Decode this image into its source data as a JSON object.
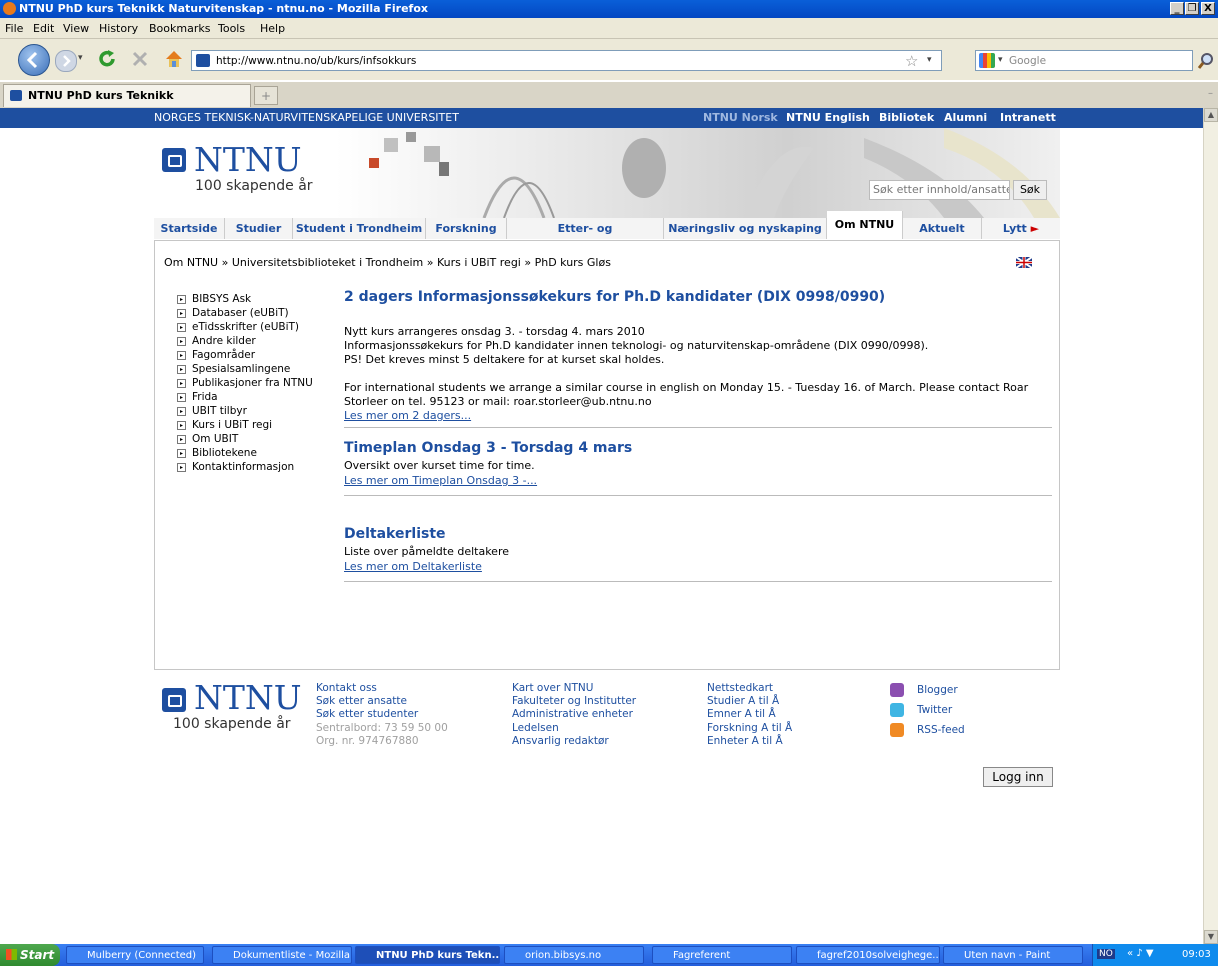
{
  "window": {
    "title": "NTNU PhD kurs Teknikk Naturvitenskap - ntnu.no - Mozilla Firefox",
    "min": "_",
    "max": "❐",
    "close": "X"
  },
  "menu": [
    "File",
    "Edit",
    "View",
    "History",
    "Bookmarks",
    "Tools",
    "Help"
  ],
  "toolbar": {
    "url": "http://www.ntnu.no/ub/kurs/infsokkurs",
    "search_placeholder": "Google",
    "star": "☆",
    "dropdown": "▾"
  },
  "tab": {
    "label": "NTNU PhD kurs Teknikk Naturvitensk...",
    "new": "+"
  },
  "site": {
    "university": "NORGES TEKNISK-NATURVITENSKAPELIGE UNIVERSITET",
    "toplinks": [
      "NTNU Norsk",
      "NTNU English",
      "Bibliotek",
      "Alumni",
      "Intranett"
    ],
    "logo": "NTNU",
    "logo_sub": "100 skapende år",
    "search_placeholder": "Søk etter innhold/ansatte",
    "search_button": "Søk",
    "tabs": [
      "Startside",
      "Studier",
      "Student i Trondheim",
      "Forskning",
      "Etter- og videreutdanning",
      "Næringsliv og nyskaping",
      "Om NTNU",
      "Aktuelt",
      "Lytt"
    ],
    "breadcrumb": "Om NTNU » Universitetsbiblioteket i Trondheim » Kurs i UBiT regi » PhD kurs Gløs"
  },
  "sidebar": [
    "BIBSYS Ask",
    "Databaser (eUBiT)",
    "eTidsskrifter (eUBiT)",
    "Andre kilder",
    "Fagområder",
    "Spesialsamlingene",
    "Publikasjoner fra NTNU",
    "Frida",
    "UBIT tilbyr",
    "Kurs i UBiT regi",
    "Om UBIT",
    "Bibliotekene",
    "Kontaktinformasjon"
  ],
  "articles": {
    "a1": {
      "title": "2 dagers Informasjonssøkekurs for Ph.D kandidater (DIX 0998/0990)",
      "p1": "Nytt kurs arrangeres onsdag 3. - torsdag 4. mars 2010",
      "p2": "Informasjonssøkekurs for Ph.D kandidater innen teknologi- og naturvitenskap-områdene (DIX 0990/0998).",
      "p3": "PS! Det kreves minst 5 deltakere for at kurset skal holdes.",
      "p4": "For international students we arrange a similar course in english on Monday 15. - Tuesday 16. of March. Please contact Roar",
      "p5": "Storleer on tel. 95123 or mail: roar.storleer@ub.ntnu.no",
      "link": "Les mer om 2 dagers..."
    },
    "a2": {
      "title": "Timeplan Onsdag 3 - Torsdag 4 mars",
      "text": "Oversikt over kurset time for time.",
      "link": "Les mer om Timeplan Onsdag 3 -..."
    },
    "a3": {
      "title": "Deltakerliste",
      "text": "Liste over påmeldte deltakere",
      "link": "Les mer om Deltakerliste"
    }
  },
  "footer": {
    "col1": [
      "Kontakt oss",
      "Søk etter ansatte",
      "Søk etter studenter"
    ],
    "col1_grey": [
      "Sentralbord: 73 59 50 00",
      "Org. nr. 974767880"
    ],
    "col2": [
      "Kart over NTNU",
      "Fakulteter og Institutter",
      "Administrative enheter",
      "Ledelsen",
      "Ansvarlig redaktør"
    ],
    "col3": [
      "Nettstedkart",
      "Studier A til Å",
      "Emner A til Å",
      "Forskning A til Å",
      "Enheter A til Å"
    ],
    "social": [
      "Blogger",
      "Twitter",
      "RSS-feed"
    ],
    "login": "Logg inn"
  },
  "taskbar": {
    "start": "Start",
    "items": [
      "Mulberry (Connected)",
      "Dokumentliste - Mozilla ...",
      "NTNU PhD kurs Tekn...",
      "orion.bibsys.no",
      "Fagreferent",
      "fagref2010solveighege...",
      "Uten navn - Paint"
    ],
    "lang": "NO",
    "clock": "09:03"
  }
}
